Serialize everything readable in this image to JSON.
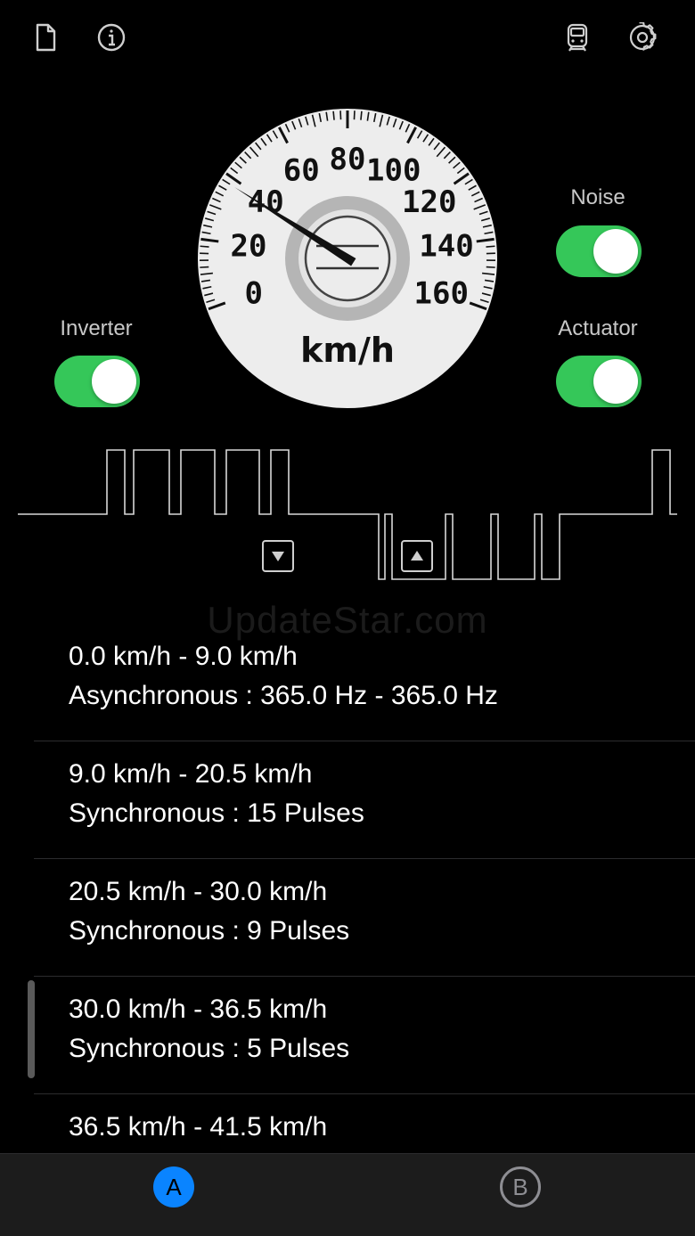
{
  "toolbar": {
    "document_icon": "document-icon",
    "info_icon": "info-icon",
    "train_icon": "train-icon",
    "settings_icon": "gear-icon"
  },
  "speedometer": {
    "unit": "km/h",
    "ticks": [
      "0",
      "20",
      "40",
      "60",
      "80",
      "100",
      "120",
      "140",
      "160"
    ],
    "speed_value": 38
  },
  "toggles": {
    "inverter": {
      "label": "Inverter",
      "on": true
    },
    "noise": {
      "label": "Noise",
      "on": true
    },
    "actuator": {
      "label": "Actuator",
      "on": true
    }
  },
  "controls": {
    "down_icon": "triangle-down-icon",
    "up_icon": "triangle-up-icon"
  },
  "watermark": "UpdateStar.com",
  "modes": [
    {
      "range": "0.0 km/h - 9.0 km/h",
      "mode": "Asynchronous : 365.0 Hz - 365.0 Hz"
    },
    {
      "range": "9.0 km/h - 20.5 km/h",
      "mode": "Synchronous : 15 Pulses"
    },
    {
      "range": "20.5 km/h - 30.0 km/h",
      "mode": "Synchronous : 9 Pulses"
    },
    {
      "range": "30.0 km/h - 36.5 km/h",
      "mode": "Synchronous : 5 Pulses"
    },
    {
      "range": "36.5 km/h - 41.5 km/h",
      "mode": ""
    }
  ],
  "tabs": [
    {
      "label": "A",
      "active": true
    },
    {
      "label": "B",
      "active": false
    }
  ],
  "colors": {
    "accent": "#0a84ff",
    "toggle_on": "#35c759",
    "background": "#000000"
  }
}
